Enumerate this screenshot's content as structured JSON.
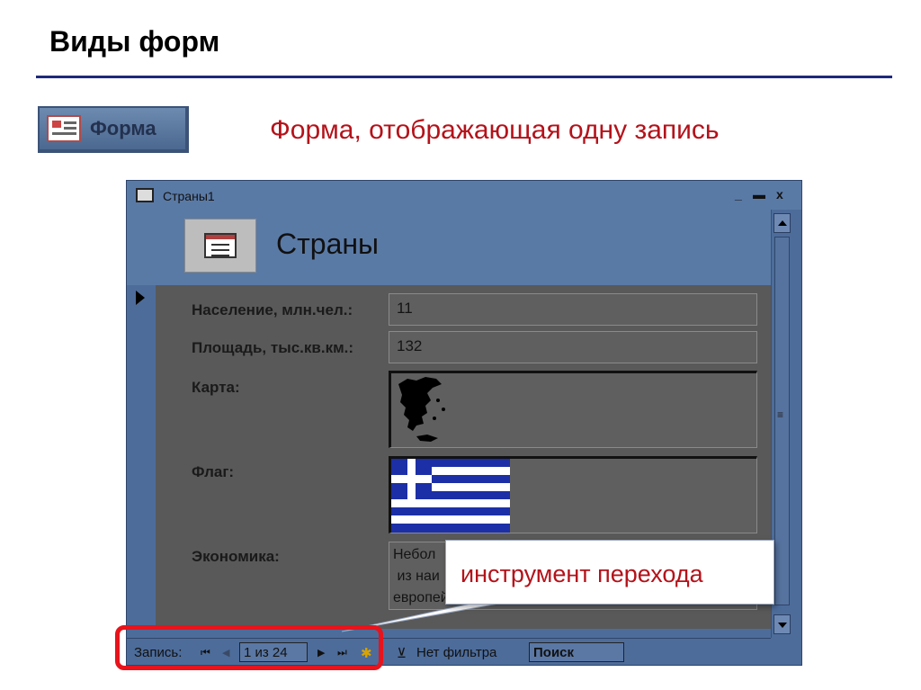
{
  "slide": {
    "title": "Виды форм",
    "button_label": "Форма",
    "subtitle": "Форма, отображающая одну запись",
    "callout": "инструмент перехода"
  },
  "window": {
    "title": "Страны1",
    "controls": {
      "minimize": "_",
      "maximize": "▬",
      "close": "x"
    },
    "form_header": "Страны"
  },
  "fields": {
    "population": {
      "label": "Население, млн.чел.:",
      "value": "11"
    },
    "area": {
      "label": "Площадь, тыс.кв.км.:",
      "value": "132"
    },
    "map": {
      "label": "Карта:"
    },
    "flag": {
      "label": "Флаг:"
    },
    "economy": {
      "label": "Экономика:",
      "lines": [
        "Небол",
        " из наи",
        "европейс              , но с великим"
      ]
    }
  },
  "navigation": {
    "label": "Запись:",
    "first": "⏮",
    "prev": "◀",
    "position": "1 из 24",
    "next": "▶",
    "last": "⏭",
    "new_record": "✱",
    "filter_icon": "⊻",
    "filter": "Нет фильтра",
    "search": "Поиск"
  },
  "colors": {
    "accent_red": "#b4121a",
    "highlight_red": "#e8131b",
    "title_rule": "#1f2a7a",
    "flag_blue": "#1d2fa6"
  }
}
